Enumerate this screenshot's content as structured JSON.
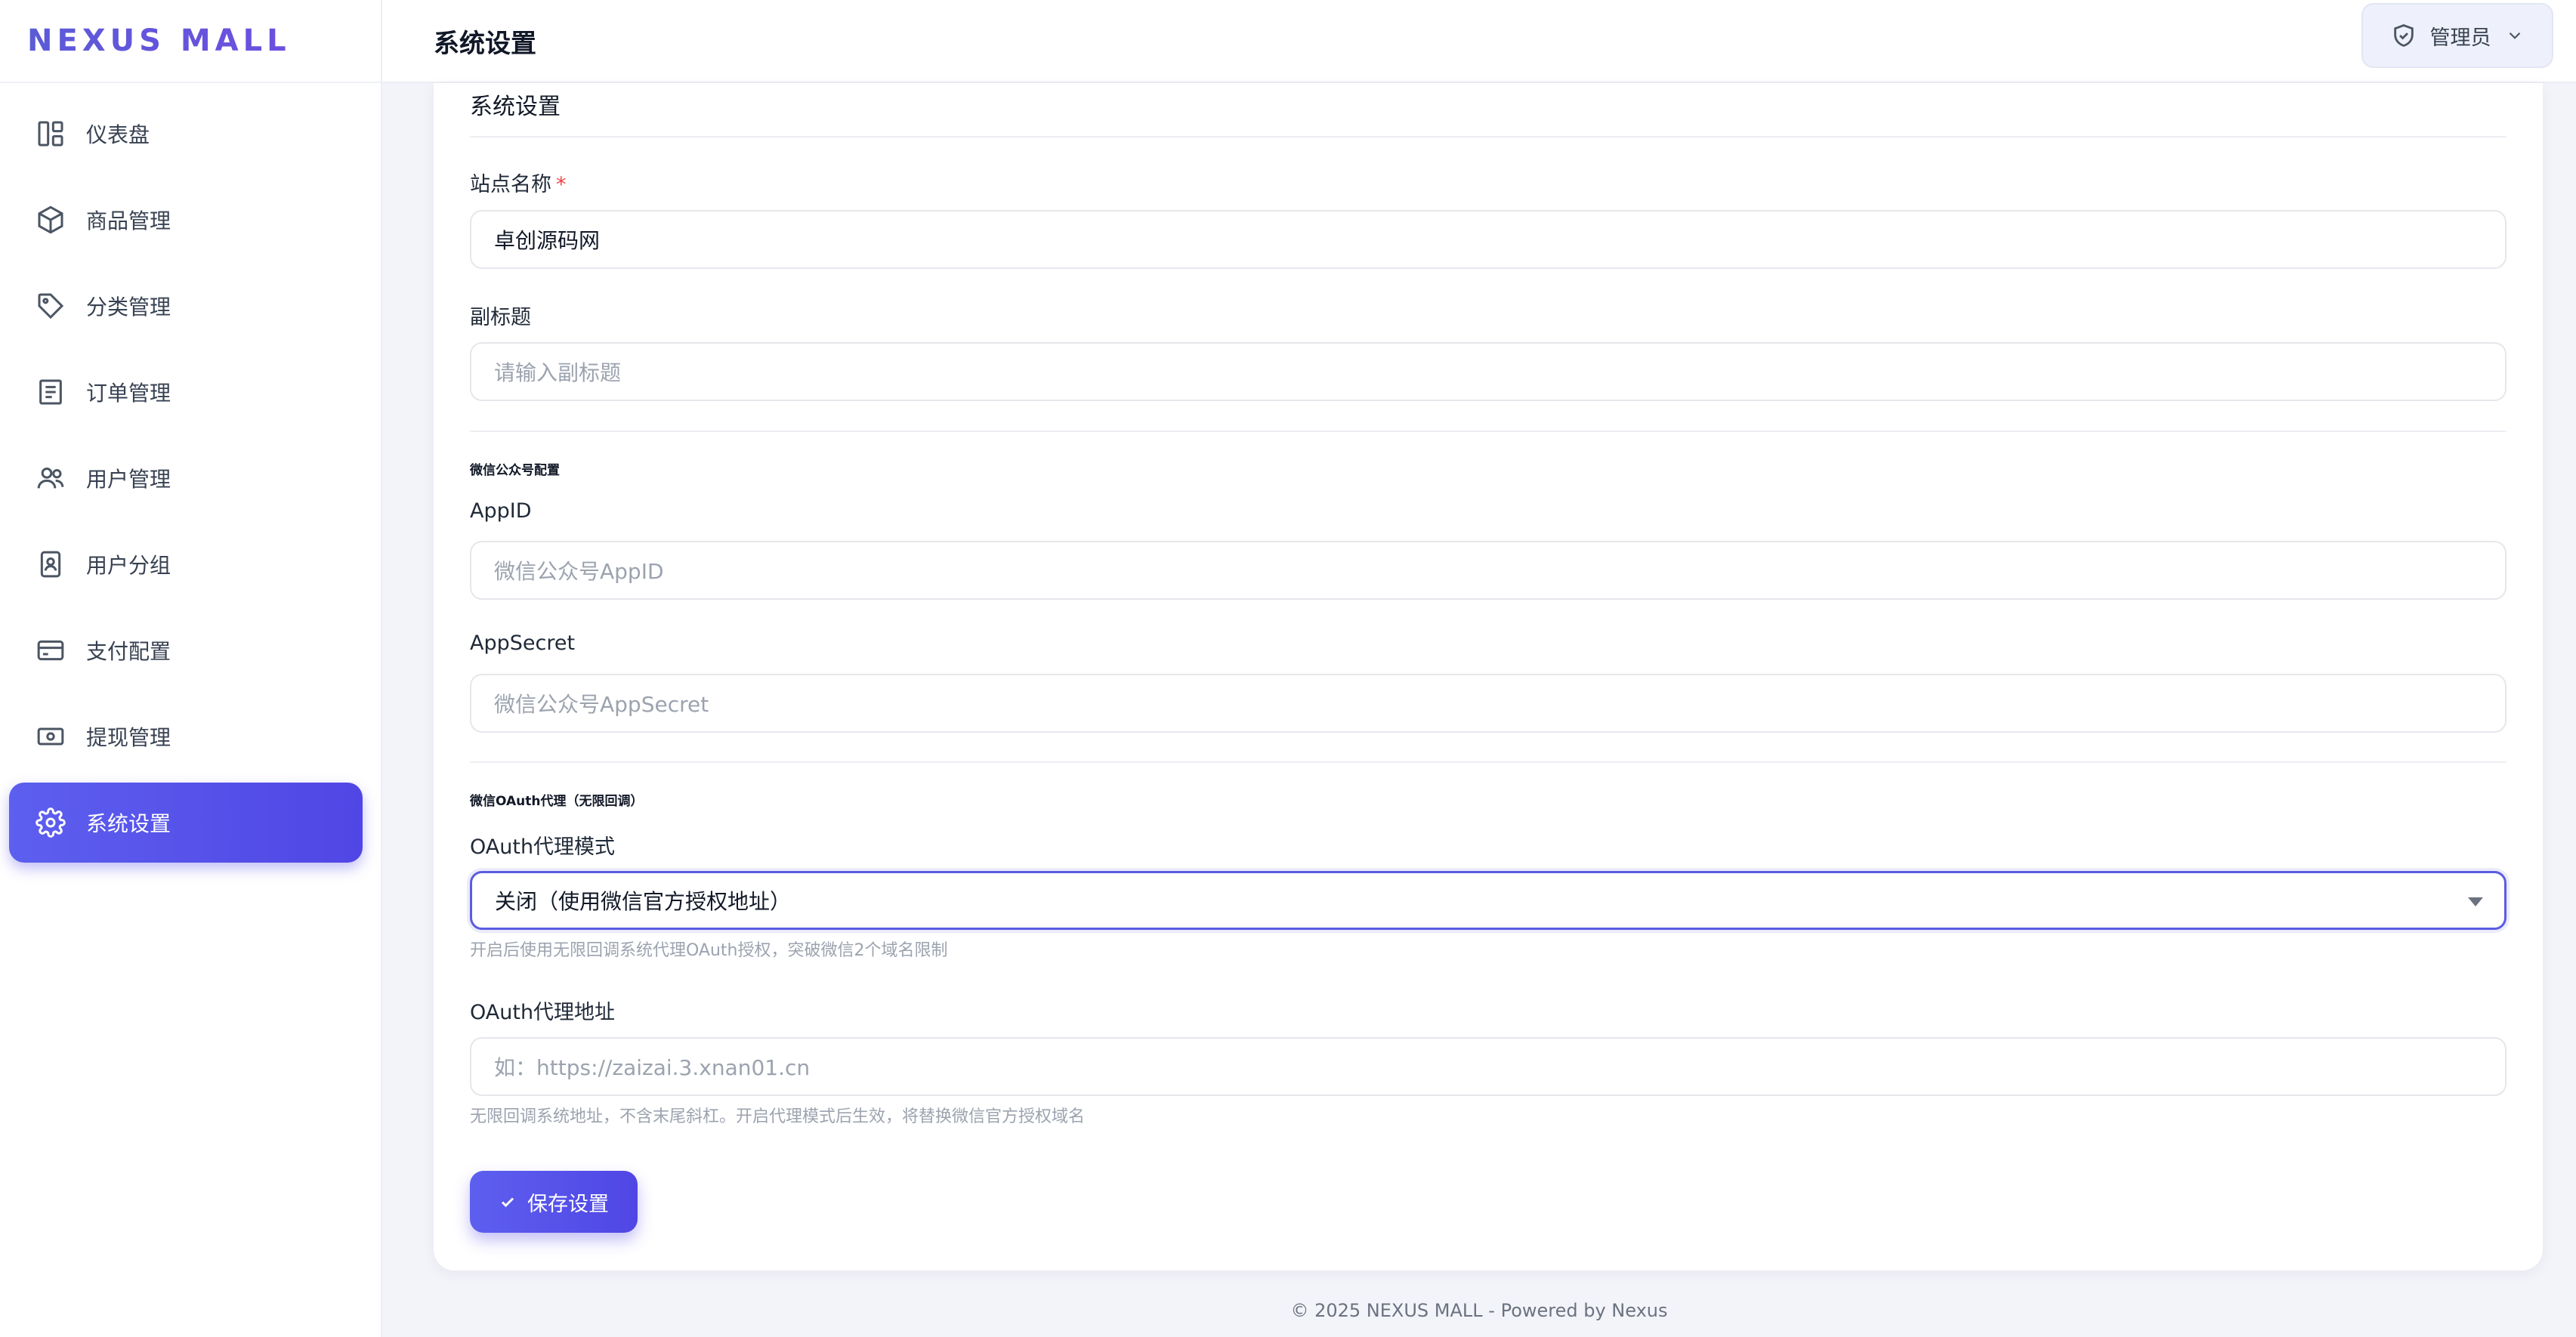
{
  "brand": "NEXUS MALL",
  "header": {
    "title": "系统设置",
    "user_label": "管理员"
  },
  "sidebar": {
    "items": [
      {
        "label": "仪表盘",
        "icon": "dashboard-icon",
        "active": false
      },
      {
        "label": "商品管理",
        "icon": "box-icon",
        "active": false
      },
      {
        "label": "分类管理",
        "icon": "tag-icon",
        "active": false
      },
      {
        "label": "订单管理",
        "icon": "receipt-icon",
        "active": false
      },
      {
        "label": "用户管理",
        "icon": "users-icon",
        "active": false
      },
      {
        "label": "用户分组",
        "icon": "badge-icon",
        "active": false
      },
      {
        "label": "支付配置",
        "icon": "credit-card-icon",
        "active": false
      },
      {
        "label": "提现管理",
        "icon": "cash-icon",
        "active": false
      },
      {
        "label": "系统设置",
        "icon": "gear-icon",
        "active": true
      }
    ]
  },
  "form": {
    "section_title": "系统设置",
    "site_name": {
      "label": "站点名称",
      "required_mark": "*",
      "value": "卓创源码网"
    },
    "subtitle": {
      "label": "副标题",
      "placeholder": "请输入副标题"
    },
    "wechat_section": "微信公众号配置",
    "appid": {
      "label": "AppID",
      "placeholder": "微信公众号AppID"
    },
    "appsecret": {
      "label": "AppSecret",
      "placeholder": "微信公众号AppSecret"
    },
    "oauth_section": "微信OAuth代理（无限回调）",
    "oauth_mode": {
      "label": "OAuth代理模式",
      "value": "关闭（使用微信官方授权地址）",
      "hint": "开启后使用无限回调系统代理OAuth授权，突破微信2个域名限制"
    },
    "oauth_url": {
      "label": "OAuth代理地址",
      "placeholder": "如：https://zaizai.3.xnan01.cn",
      "hint": "无限回调系统地址，不含末尾斜杠。开启代理模式后生效，将替换微信官方授权域名"
    },
    "save_label": "保存设置"
  },
  "footer": "© 2025 NEXUS MALL - Powered by Nexus"
}
